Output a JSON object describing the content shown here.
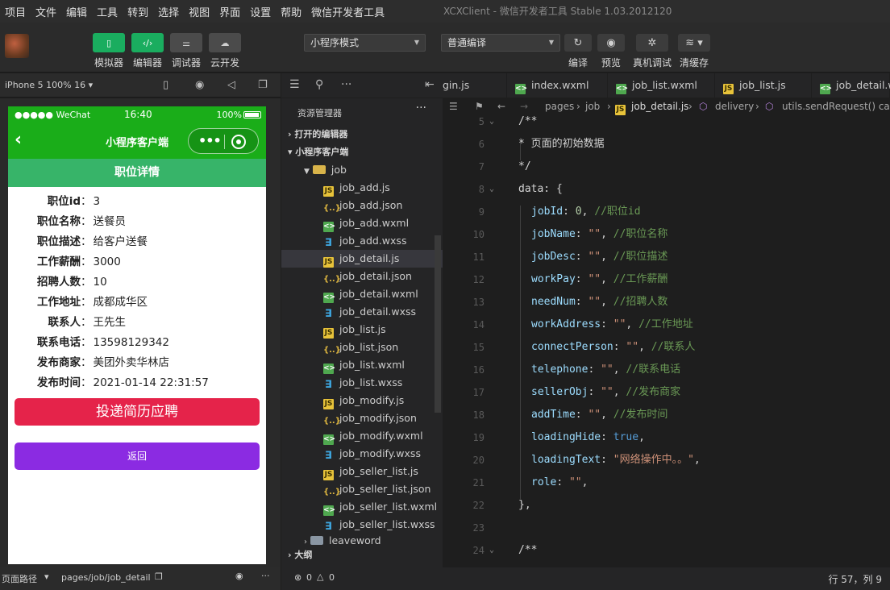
{
  "menubar": {
    "items": [
      "项目",
      "文件",
      "编辑",
      "工具",
      "转到",
      "选择",
      "视图",
      "界面",
      "设置",
      "帮助",
      "微信开发者工具"
    ],
    "window_title": "XCXClient - 微信开发者工具 Stable 1.03.2012120"
  },
  "toolbar": {
    "simulator_label": "模拟器",
    "editor_label": "编辑器",
    "debugger_label": "调试器",
    "cloud_label": "云开发",
    "mode_select": "小程序模式",
    "compile_select": "普通编译",
    "compile_label": "编译",
    "preview_label": "预览",
    "remote_debug_label": "真机调试",
    "clear_cache_label": "清缓存"
  },
  "simulator": {
    "device": "iPhone 5 100% 16",
    "status_left": "●●●●● WeChat",
    "status_time": "16:40",
    "status_battery": "100%",
    "nav_title": "小程序客户端",
    "page_title": "职位详情",
    "details": [
      {
        "label": "职位id",
        "value": "3"
      },
      {
        "label": "职位名称",
        "value": "送餐员"
      },
      {
        "label": "职位描述",
        "value": "给客户送餐"
      },
      {
        "label": "工作薪酬",
        "value": "3000"
      },
      {
        "label": "招聘人数",
        "value": "10"
      },
      {
        "label": "工作地址",
        "value": "成都成华区"
      },
      {
        "label": "联系人",
        "value": "王先生"
      },
      {
        "label": "联系电话",
        "value": "13598129342"
      },
      {
        "label": "发布商家",
        "value": "美团外卖华林店"
      },
      {
        "label": "发布时间",
        "value": "2021-01-14 22:31:57"
      }
    ],
    "apply_button": "投递简历应聘",
    "back_button": "返回",
    "path_label": "页面路径",
    "path_value": "pages/job/job_detail"
  },
  "explorer": {
    "title": "资源管理器",
    "open_editors": "打开的编辑器",
    "project": "小程序客户端",
    "folder": "job",
    "files": [
      {
        "name": "job_add.js",
        "type": "js"
      },
      {
        "name": "job_add.json",
        "type": "json"
      },
      {
        "name": "job_add.wxml",
        "type": "wxml"
      },
      {
        "name": "job_add.wxss",
        "type": "wxss"
      },
      {
        "name": "job_detail.js",
        "type": "js"
      },
      {
        "name": "job_detail.json",
        "type": "json"
      },
      {
        "name": "job_detail.wxml",
        "type": "wxml"
      },
      {
        "name": "job_detail.wxss",
        "type": "wxss"
      },
      {
        "name": "job_list.js",
        "type": "js"
      },
      {
        "name": "job_list.json",
        "type": "json"
      },
      {
        "name": "job_list.wxml",
        "type": "wxml"
      },
      {
        "name": "job_list.wxss",
        "type": "wxss"
      },
      {
        "name": "job_modify.js",
        "type": "js"
      },
      {
        "name": "job_modify.json",
        "type": "json"
      },
      {
        "name": "job_modify.wxml",
        "type": "wxml"
      },
      {
        "name": "job_modify.wxss",
        "type": "wxss"
      },
      {
        "name": "job_seller_list.js",
        "type": "js"
      },
      {
        "name": "job_seller_list.json",
        "type": "json"
      },
      {
        "name": "job_seller_list.wxml",
        "type": "wxml"
      },
      {
        "name": "job_seller_list.wxss",
        "type": "wxss"
      }
    ],
    "next_folder": "leaveword",
    "outline": "大纲",
    "problems": "0",
    "warnings": "0"
  },
  "editor": {
    "tabs": [
      "gin.js",
      "index.wxml",
      "job_list.wxml",
      "job_list.js",
      "job_detail.w"
    ],
    "breadcrumb": [
      "pages",
      "job",
      "job_detail.js",
      "delivery",
      "utils.sendRequest() callb"
    ],
    "status_position": "行 57，列 9",
    "lines": [
      {
        "n": "5",
        "text": "/**"
      },
      {
        "n": "6",
        "text": " * 页面的初始数据"
      },
      {
        "n": "7",
        "text": " */"
      },
      {
        "n": "8",
        "text": "data: {"
      },
      {
        "n": "9",
        "key": "jobId",
        "value": "0",
        "comment": "//职位id"
      },
      {
        "n": "10",
        "key": "jobName",
        "value": "\"\"",
        "comment": "//职位名称"
      },
      {
        "n": "11",
        "key": "jobDesc",
        "value": "\"\"",
        "comment": "//职位描述"
      },
      {
        "n": "12",
        "key": "workPay",
        "value": "\"\"",
        "comment": "//工作薪酬"
      },
      {
        "n": "13",
        "key": "needNum",
        "value": "\"\"",
        "comment": "//招聘人数"
      },
      {
        "n": "14",
        "key": "workAddress",
        "value": "\"\"",
        "comment": "//工作地址"
      },
      {
        "n": "15",
        "key": "connectPerson",
        "value": "\"\"",
        "comment": "//联系人"
      },
      {
        "n": "16",
        "key": "telephone",
        "value": "\"\"",
        "comment": "//联系电话"
      },
      {
        "n": "17",
        "key": "sellerObj",
        "value": "\"\"",
        "comment": "//发布商家"
      },
      {
        "n": "18",
        "key": "addTime",
        "value": "\"\"",
        "comment": "//发布时间"
      },
      {
        "n": "19",
        "key": "loadingHide",
        "value": "true",
        "comment": ""
      },
      {
        "n": "20",
        "key": "loadingText",
        "value": "\"网络操作中。。\"",
        "comment": ""
      },
      {
        "n": "21",
        "key": "role",
        "value": "\"\"",
        "comment": ""
      },
      {
        "n": "22",
        "text": "},"
      },
      {
        "n": "23",
        "text": ""
      },
      {
        "n": "24",
        "text": "/**"
      }
    ]
  }
}
